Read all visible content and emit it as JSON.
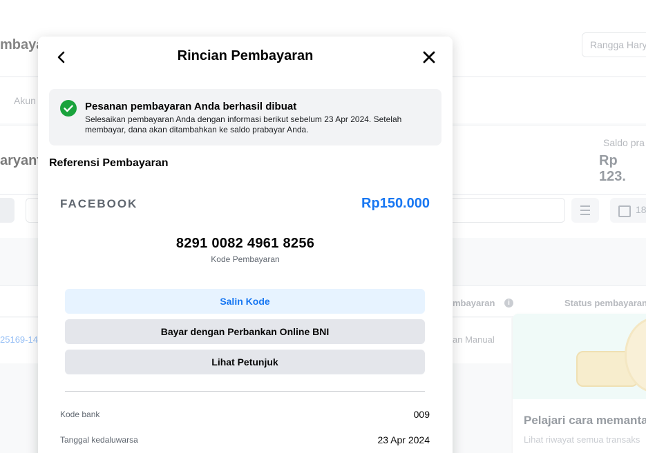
{
  "background": {
    "page_title": "mbaya",
    "user_selector": "Rangga Hary",
    "tab_label": "Akun",
    "account_name": "aryanto",
    "balance_label": "Saldo pra",
    "balance_value": "Rp 123.",
    "date_filter": "18",
    "table_headers": {
      "payment_method": "mbayaran",
      "payment_status": "Status pembayaran"
    },
    "row": {
      "id": "25169-14",
      "method": "an Manual"
    },
    "promo_card": {
      "title": "Pelajari cara memanta",
      "subtitle": "Lihat riwayat semua transaks"
    }
  },
  "modal": {
    "title": "Rincian Pembayaran",
    "back_icon": "chevron-left-icon",
    "close_icon": "close-icon",
    "notice": {
      "icon": "check-circle-icon",
      "color": "#1aa33c",
      "title": "Pesanan pembayaran Anda berhasil dibuat",
      "text": "Selesaikan pembayaran Anda dengan informasi berikut sebelum 23 Apr 2024. Setelah membayar, dana akan ditambahkan ke saldo prabayar Anda."
    },
    "reference_heading": "Referensi Pembayaran",
    "merchant": "FACEBOOK",
    "amount": "Rp150.000",
    "amount_color": "#1877f2",
    "payment_code": "8291 0082 4961 8256",
    "payment_code_label": "Kode Pembayaran",
    "buttons": {
      "copy_code": "Salin Kode",
      "pay_online": "Bayar dengan Perbankan Online BNI",
      "view_guide": "Lihat Petunjuk"
    },
    "details": [
      {
        "label": "Kode bank",
        "value": "009"
      },
      {
        "label": "Tanggal kedaluwarsa",
        "value": "23 Apr 2024"
      }
    ]
  }
}
